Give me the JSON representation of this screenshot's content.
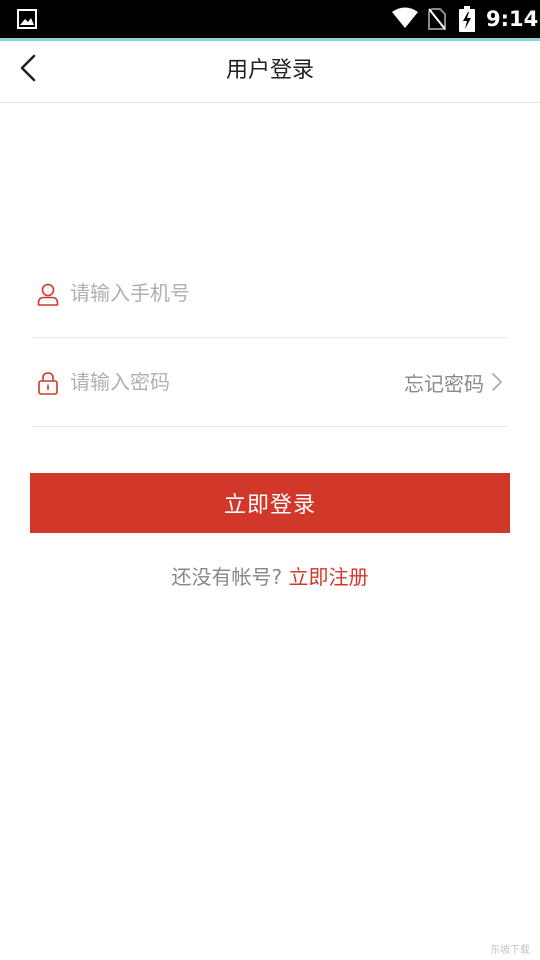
{
  "status_bar": {
    "time": "9:14",
    "icons": [
      "gallery-icon",
      "wifi-icon",
      "no-sim-icon",
      "battery-charging-icon"
    ]
  },
  "app_bar": {
    "title": "用户登录",
    "back_icon": "chevron-left-icon"
  },
  "form": {
    "phone": {
      "placeholder": "请输入手机号",
      "value": "",
      "icon": "user-icon"
    },
    "password": {
      "placeholder": "请输入密码",
      "value": "",
      "icon": "lock-icon"
    },
    "forgot_label": "忘记密码"
  },
  "login_button": "立即登录",
  "register": {
    "prompt": "还没有帐号?",
    "link": "立即注册"
  },
  "watermark": "东坡下载",
  "colors": {
    "accent": "#d2382a",
    "status_bar": "#000000",
    "status_strip": "#8fd3d6"
  }
}
